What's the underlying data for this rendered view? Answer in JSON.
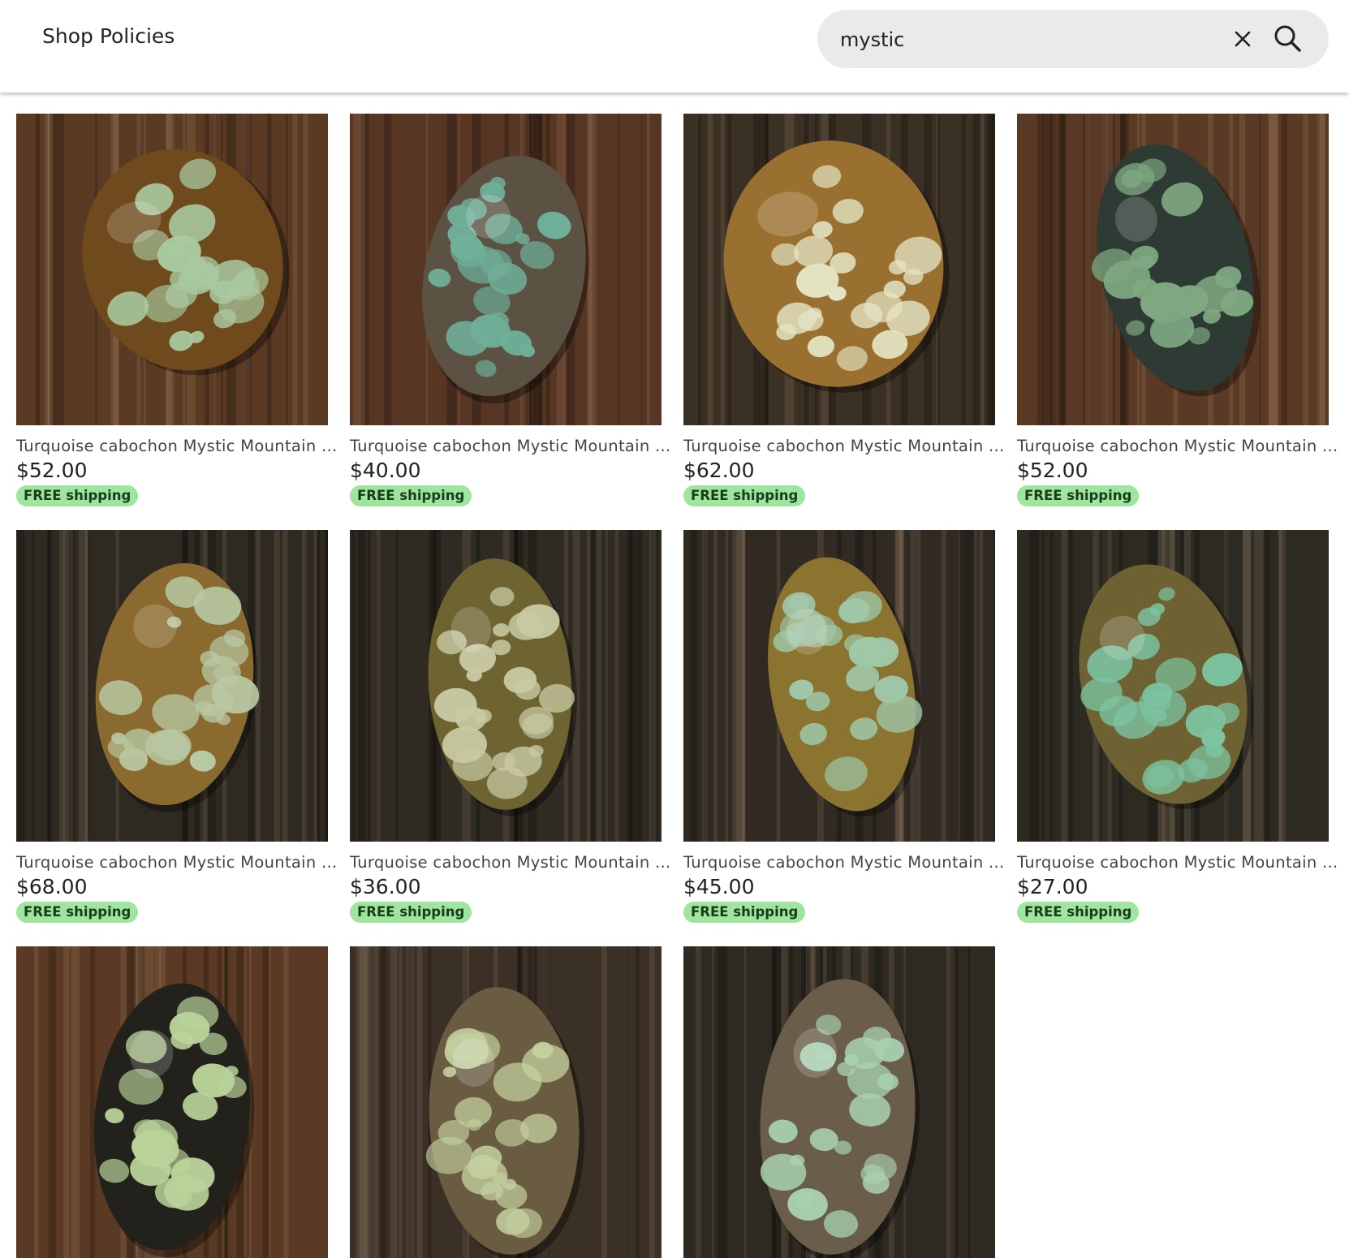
{
  "header": {
    "nav_link": "Shop Policies",
    "search": {
      "value": "mystic",
      "clear_icon": "close-icon",
      "submit_icon": "search-icon"
    }
  },
  "listings": [
    {
      "title": "Turquoise cabochon Mystic Mountain ...",
      "price": "$52.00",
      "badge": "FREE shipping",
      "wood": "#5b3a24",
      "stone": "#a9c9a0",
      "matrix": "#6e4a1c"
    },
    {
      "title": "Turquoise cabochon Mystic Mountain ...",
      "price": "$40.00",
      "badge": "FREE shipping",
      "wood": "#573624",
      "stone": "#6fb09a",
      "matrix": "#5c5244"
    },
    {
      "title": "Turquoise cabochon Mystic Mountain ...",
      "price": "$62.00",
      "badge": "FREE shipping",
      "wood": "#3b3024",
      "stone": "#e3e4c4",
      "matrix": "#9a7030"
    },
    {
      "title": "Turquoise cabochon Mystic Mountain ...",
      "price": "$52.00",
      "badge": "FREE shipping",
      "wood": "#5a3a24",
      "stone": "#7fa882",
      "matrix": "#2e3a34"
    },
    {
      "title": "Turquoise cabochon Mystic Mountain ...",
      "price": "$68.00",
      "badge": "FREE shipping",
      "wood": "#2e2a22",
      "stone": "#b8c9a4",
      "matrix": "#8a6a2e"
    },
    {
      "title": "Turquoise cabochon Mystic Mountain ...",
      "price": "$36.00",
      "badge": "FREE shipping",
      "wood": "#2f2a22",
      "stone": "#c9caa4",
      "matrix": "#6d6432"
    },
    {
      "title": "Turquoise cabochon Mystic Mountain ...",
      "price": "$45.00",
      "badge": "FREE shipping",
      "wood": "#302a22",
      "stone": "#9fc7a8",
      "matrix": "#8a7430"
    },
    {
      "title": "Turquoise cabochon Mystic Mountain ...",
      "price": "$27.00",
      "badge": "FREE shipping",
      "wood": "#2d2a22",
      "stone": "#7cc3a0",
      "matrix": "#6e6232"
    },
    {
      "title": "",
      "price": "",
      "badge": "",
      "wood": "#5a3a24",
      "stone": "#b9d39a",
      "matrix": "#23211c"
    },
    {
      "title": "",
      "price": "",
      "badge": "",
      "wood": "#3a3026",
      "stone": "#c3cf9e",
      "matrix": "#6a5c40"
    },
    {
      "title": "",
      "price": "",
      "badge": "",
      "wood": "#2e2a22",
      "stone": "#a8d0b0",
      "matrix": "#6a5e4a"
    }
  ]
}
